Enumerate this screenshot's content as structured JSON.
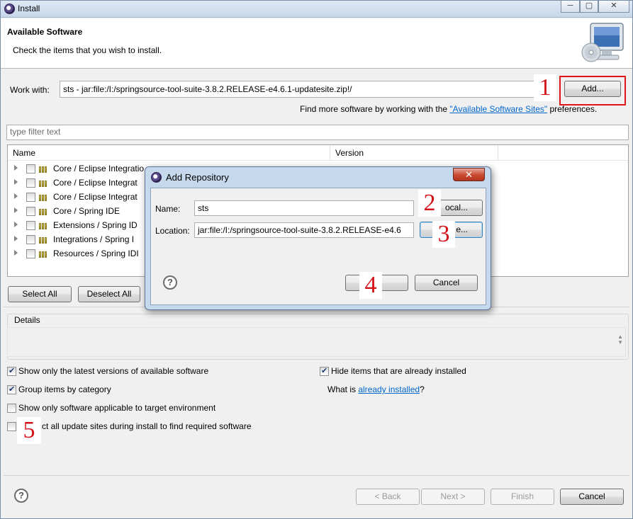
{
  "window": {
    "title": "Install",
    "caption_buttons": [
      "─",
      "▢",
      "✕"
    ]
  },
  "header": {
    "title": "Available Software",
    "description": "Check the items that you wish to install.",
    "icon": "monitor-cd-icon"
  },
  "work_with": {
    "label": "Work with:",
    "value": "sts - jar:file:/I:/springsource-tool-suite-3.8.2.RELEASE-e4.6.1-updatesite.zip!/",
    "add_button": "Add...",
    "find_more_prefix": "Find more software by working with the ",
    "find_more_link": "\"Available Software Sites\"",
    "find_more_suffix": " preferences."
  },
  "filter": {
    "placeholder": "type filter text"
  },
  "tree": {
    "columns": [
      "Name",
      "Version"
    ],
    "rows": [
      {
        "label": "Core / Eclipse Integratio",
        "checked": false
      },
      {
        "label": "Core / Eclipse Integrat",
        "checked": false
      },
      {
        "label": "Core / Eclipse Integrat",
        "checked": false
      },
      {
        "label": "Core / Spring IDE",
        "checked": false
      },
      {
        "label": "Extensions / Spring ID",
        "checked": false
      },
      {
        "label": "Integrations / Spring I",
        "checked": false
      },
      {
        "label": "Resources / Spring IDI",
        "checked": false
      }
    ]
  },
  "buttons": {
    "select_all": "Select All",
    "deselect_all": "Deselect All",
    "back": "< Back",
    "next": "Next >",
    "finish": "Finish",
    "cancel": "Cancel"
  },
  "details": {
    "label": "Details"
  },
  "options": {
    "latest_versions": {
      "label": "Show only the latest versions of available software",
      "checked": true
    },
    "group_by_category": {
      "label": "Group items by category",
      "checked": true
    },
    "target_env": {
      "label": "Show only software applicable to target environment",
      "checked": false
    },
    "contact_sites": {
      "label": "ct all update sites during install to find required software",
      "checked": false
    },
    "hide_installed": {
      "label": "Hide items that are already installed",
      "checked": true
    },
    "what_is_prefix": "What is ",
    "what_is_link": "already installed",
    "what_is_suffix": "?"
  },
  "dialog": {
    "title": "Add Repository",
    "name_label": "Name:",
    "name_value": "sts",
    "location_label": "Location:",
    "location_value": "jar:file:/I:/springsource-tool-suite-3.8.2.RELEASE-e4.6",
    "local_button": "ocal...",
    "archive_button": "e...",
    "cancel_button": "Cancel",
    "close_glyph": "✕"
  },
  "annotations": [
    "1",
    "2",
    "3",
    "4",
    "5"
  ],
  "colors": {
    "annotation": "#e2141b",
    "link": "#0066cc",
    "titlebar": "#c6d6ea"
  }
}
